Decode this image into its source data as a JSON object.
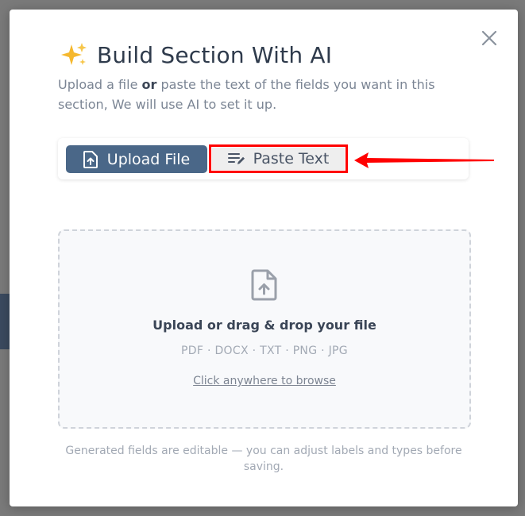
{
  "modal": {
    "title": "Build Section With AI",
    "subtitle_part1": "Upload a file ",
    "subtitle_bold": "or",
    "subtitle_part2": " paste the text of the fields you want in this section, We will use AI to set it up."
  },
  "tabs": {
    "upload_label": "Upload File",
    "paste_label": "Paste Text",
    "active": "upload"
  },
  "dropzone": {
    "title": "Upload or drag & drop your file",
    "formats": "PDF · DOCX · TXT · PNG · JPG",
    "browse_label": "Click anywhere to browse"
  },
  "footnote": "Generated fields are editable — you can adjust labels and types before saving.",
  "icons": {
    "close": "close-icon",
    "sparkle": "sparkles-icon",
    "upload": "file-upload-icon",
    "paste": "text-edit-icon",
    "dropzone": "file-upload-icon",
    "annotation": "red-arrow-icon"
  },
  "colors": {
    "accent": "#4a6788",
    "highlight": "#ff0000",
    "sparkle": "#f5b82e"
  }
}
